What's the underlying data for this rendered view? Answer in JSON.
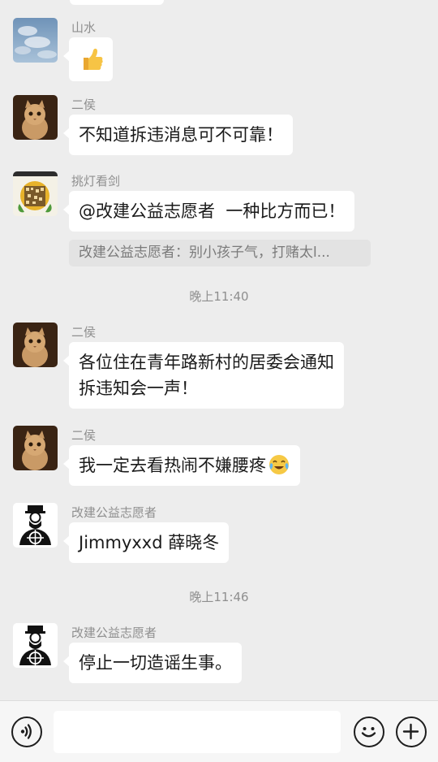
{
  "messages": [
    {
      "sender": "山水",
      "text": "👍"
    },
    {
      "sender": "二侯",
      "text": "不知道拆违消息可不可靠！"
    },
    {
      "sender": "挑灯看剑",
      "text": "@改建公益志愿者  一种比方而已！",
      "quote": "改建公益志愿者：别小孩子气，打赌太l..."
    },
    {
      "time": "晚上11:40"
    },
    {
      "sender": "二侯",
      "lines": [
        "各位住在青年路新村的居委会通知",
        "拆违知会一声！"
      ]
    },
    {
      "sender": "二侯",
      "text": "我一定去看热闹不嫌腰疼"
    },
    {
      "sender": "改建公益志愿者",
      "text": "Jimmyxxd 薛晓冬"
    },
    {
      "time": "晚上11:46"
    },
    {
      "sender": "改建公益志愿者",
      "text": "停止一切造谣生事。"
    }
  ],
  "icons": {
    "voice": "voice-icon",
    "emoji": "emoji-icon",
    "plus": "plus-icon",
    "thumbs_up": "thumbs-up-icon",
    "crying_laughing": "crying-laughing-emoji"
  },
  "colors": {
    "background": "#ededed",
    "bubble": "#ffffff",
    "meta_text": "#8f8f8f"
  }
}
